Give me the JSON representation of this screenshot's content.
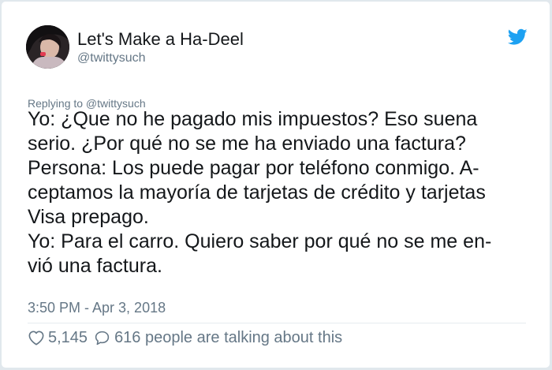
{
  "tweet": {
    "author": {
      "display_name": "Let's Make a Ha-Deel",
      "handle": "@twittysuch",
      "avatar_icon": "user-avatar"
    },
    "brand_icon": "twitter-bird-icon",
    "reply_to": "Replying to @twittysuch",
    "text_lines": [
      "Yo: ¿Que no he pagado mis impuestos? Eso suena",
      "serio. ¿Por qué no se me ha enviado una factura?",
      "Persona: Los puede pagar por teléfono conmigo. A-",
      "ceptamos la mayoría de tarjetas de crédito y tarjetas",
      "Visa prepago.",
      "Yo: Para el carro. Quiero saber por qué no se me en-",
      "vió una factura."
    ],
    "timestamp": "3:50 PM - Apr 3, 2018",
    "likes": "5,145",
    "conversation": "616 people are talking about this"
  },
  "colors": {
    "primary_text": "#14171a",
    "secondary_text": "#657786",
    "brand_blue": "#1da1f2",
    "border": "#e1e8ed"
  }
}
